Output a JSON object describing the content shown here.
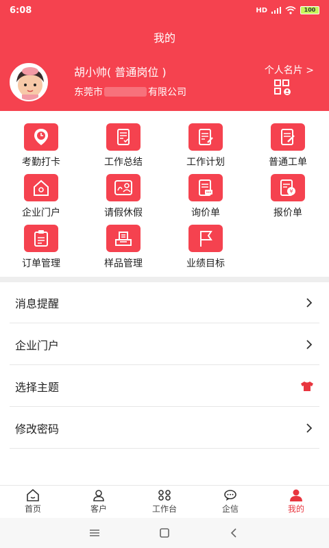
{
  "status_bar": {
    "time": "6:08",
    "network": "HD",
    "battery": "100"
  },
  "header": {
    "title": "我的"
  },
  "profile": {
    "name": "胡小帅( 普通岗位 )",
    "company_prefix": "东莞市",
    "company_suffix": "有限公司",
    "card_link": "个人名片 >"
  },
  "grid": [
    {
      "label": "考勤打卡",
      "icon": "location-clock-icon"
    },
    {
      "label": "工作总结",
      "icon": "scroll-check-icon"
    },
    {
      "label": "工作计划",
      "icon": "doc-edit-icon"
    },
    {
      "label": "普通工单",
      "icon": "doc-pen-icon"
    },
    {
      "label": "企业门户",
      "icon": "home-icon"
    },
    {
      "label": "请假休假",
      "icon": "leave-icon"
    },
    {
      "label": "询价单",
      "icon": "inquiry-icon"
    },
    {
      "label": "报价单",
      "icon": "quote-icon"
    },
    {
      "label": "订单管理",
      "icon": "clipboard-icon"
    },
    {
      "label": "样品管理",
      "icon": "sample-tray-icon"
    },
    {
      "label": "业绩目标",
      "icon": "flag-icon"
    }
  ],
  "menu": [
    {
      "label": "消息提醒",
      "icon": "chevron-right-icon"
    },
    {
      "label": "企业门户",
      "icon": "chevron-right-icon"
    },
    {
      "label": "选择主题",
      "icon": "tshirt-icon",
      "accent": "#e8363f"
    },
    {
      "label": "修改密码",
      "icon": "chevron-right-icon"
    }
  ],
  "tabs": [
    {
      "label": "首页",
      "icon": "home-icon"
    },
    {
      "label": "客户",
      "icon": "customer-icon"
    },
    {
      "label": "工作台",
      "icon": "command-icon"
    },
    {
      "label": "企信",
      "icon": "chat-icon"
    },
    {
      "label": "我的",
      "icon": "user-icon",
      "active": true
    }
  ],
  "colors": {
    "brand": "#f5424f",
    "active": "#e8363f"
  }
}
